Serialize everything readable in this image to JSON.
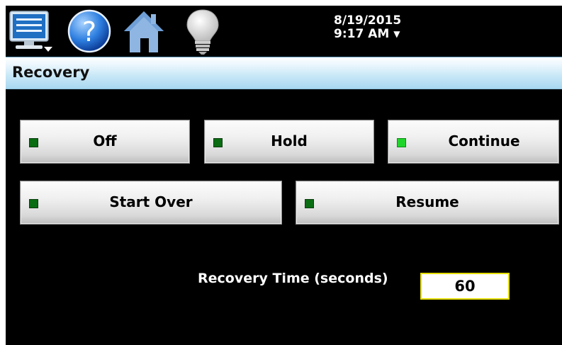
{
  "toolbar": {
    "icons": [
      "monitor-menu-icon",
      "help-icon",
      "home-icon",
      "lightbulb-icon"
    ],
    "date": "8/19/2015",
    "time": "9:17 AM",
    "dropdown_glyph": "▼"
  },
  "header": {
    "title": "Recovery"
  },
  "buttons": {
    "off": {
      "label": "Off",
      "led": "off"
    },
    "hold": {
      "label": "Hold",
      "led": "off"
    },
    "continue": {
      "label": "Continue",
      "led": "on"
    },
    "start_over": {
      "label": "Start Over",
      "led": "off"
    },
    "resume": {
      "label": "Resume",
      "led": "off"
    }
  },
  "recovery_time": {
    "label": "Recovery Time (seconds)",
    "value": "60"
  },
  "colors": {
    "led_off": "#0a6d12",
    "led_on": "#1fd52a",
    "input_border": "#e4de00",
    "titlebar": "#c7e7f7"
  }
}
